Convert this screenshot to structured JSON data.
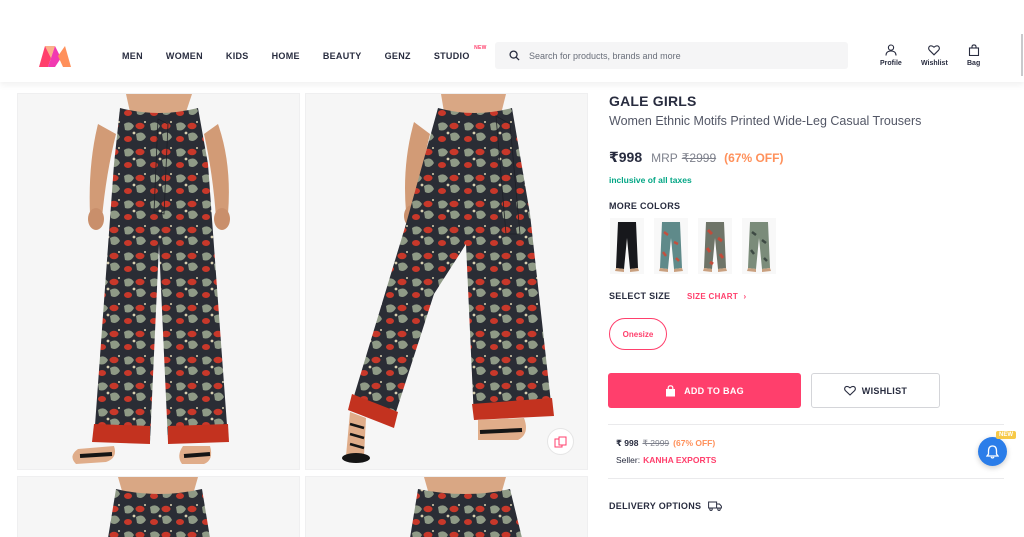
{
  "header": {
    "nav": [
      {
        "label": "MEN"
      },
      {
        "label": "WOMEN"
      },
      {
        "label": "KIDS"
      },
      {
        "label": "HOME"
      },
      {
        "label": "BEAUTY"
      },
      {
        "label": "GENZ"
      },
      {
        "label": "STUDIO",
        "badge": "NEW"
      }
    ],
    "search_placeholder": "Search for products, brands and more",
    "actions": {
      "profile": "Profile",
      "wishlist": "Wishlist",
      "bag": "Bag"
    }
  },
  "product": {
    "brand": "GALE GIRLS",
    "name": "Women Ethnic Motifs Printed Wide-Leg Casual Trousers",
    "price": "₹998",
    "mrp_label": "MRP",
    "mrp": "₹2999",
    "discount": "(67% OFF)",
    "tax_note": "inclusive of all taxes",
    "more_colors_label": "MORE COLORS",
    "select_size_label": "SELECT SIZE",
    "size_chart_label": "SIZE CHART",
    "sizes": [
      "Onesize"
    ],
    "add_to_bag": "ADD TO BAG",
    "wishlist": "WISHLIST",
    "seller_offer": {
      "price": "₹ 998",
      "mrp": "₹ 2999",
      "discount": "(67% OFF)",
      "seller_label": "Seller:",
      "seller_name": "KANHA EXPORTS"
    },
    "delivery_label": "DELIVERY OPTIONS"
  },
  "floating": {
    "new_badge": "NEW"
  },
  "colors": {
    "brand_pink": "#ff3f6c",
    "discount_orange": "#ff905a",
    "tax_green": "#03a685",
    "notif_blue": "#2b7de9",
    "print_red": "#c8382a",
    "print_dark": "#2a2d35",
    "print_sage": "#8f9a86"
  }
}
